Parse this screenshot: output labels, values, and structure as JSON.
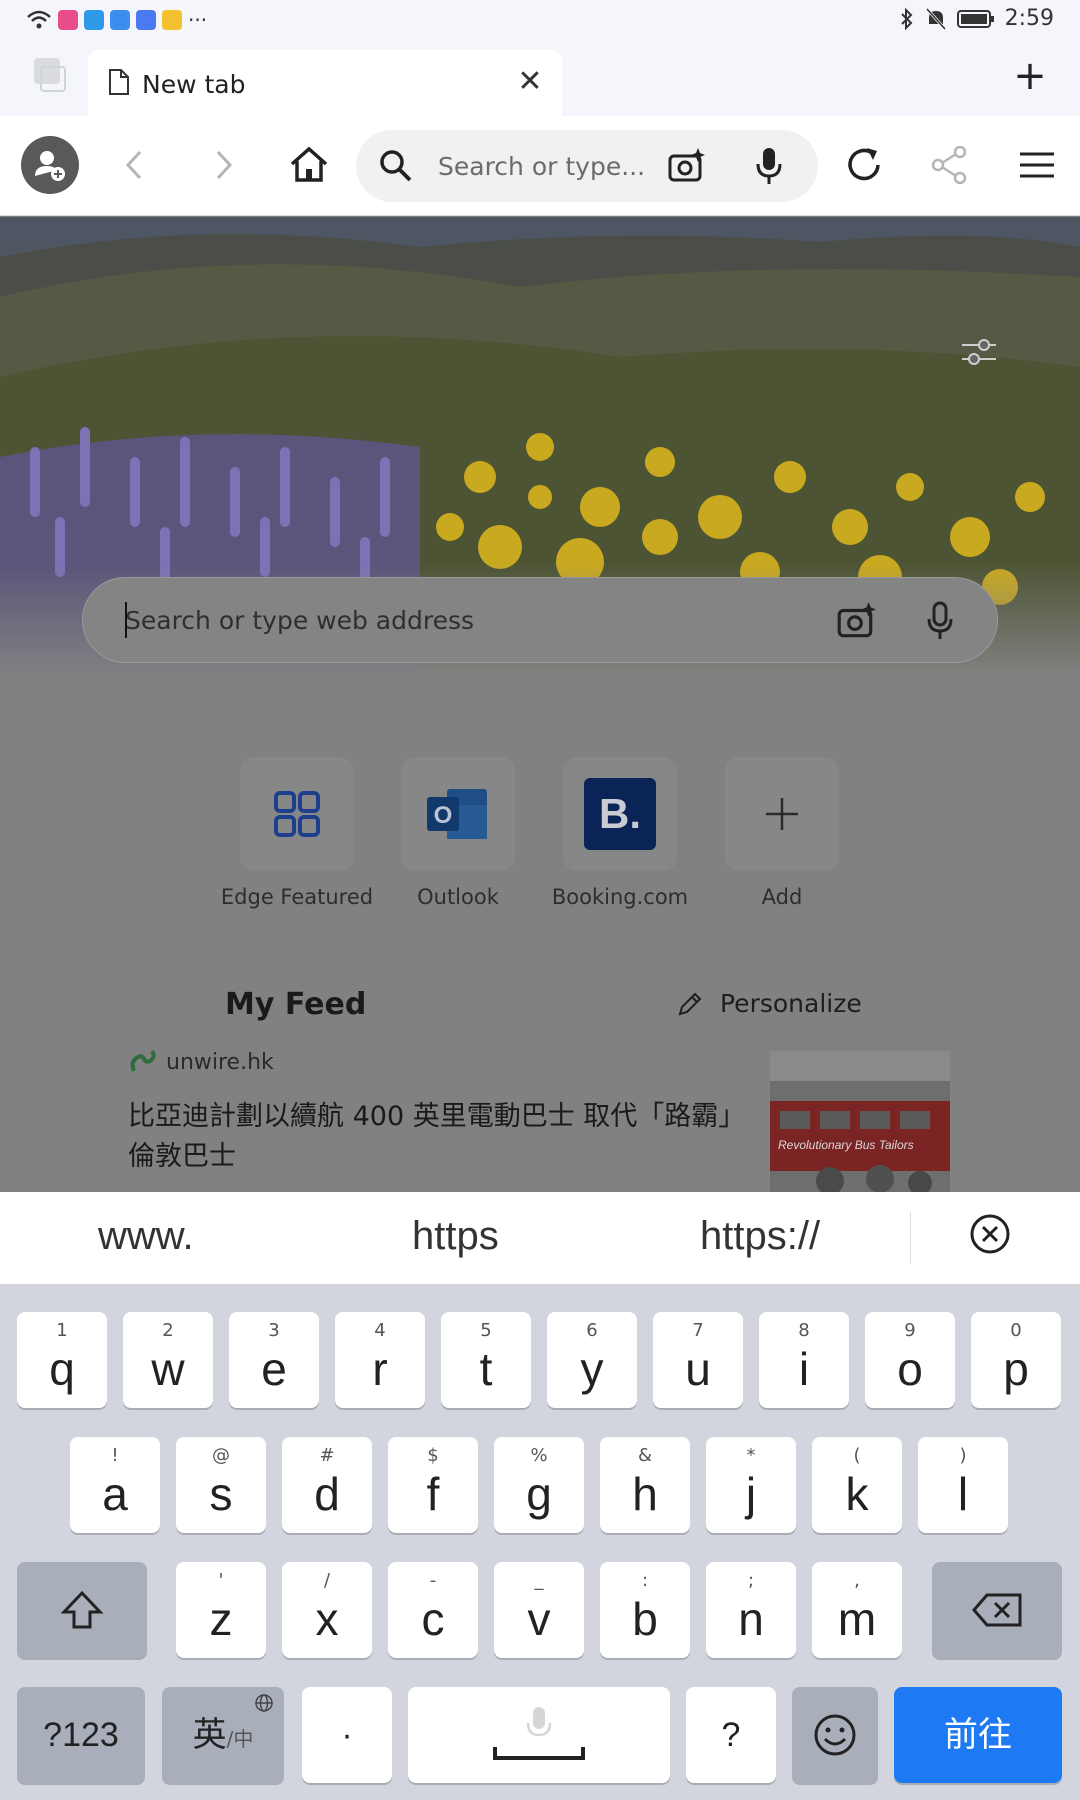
{
  "status_bar": {
    "time": "2:59",
    "notification_icons": [
      "wifi-icon",
      "app-icon-1",
      "app-icon-2",
      "cloud-icon",
      "mail-icon",
      "message-icon"
    ],
    "more_indicator": "···"
  },
  "tab": {
    "title": "New tab"
  },
  "toolbar": {
    "address_placeholder": "Search or type..."
  },
  "page": {
    "search_placeholder": "Search or type web address",
    "quick_links": [
      {
        "label": "Edge Featured",
        "icon": "grid-icon"
      },
      {
        "label": "Outlook",
        "icon": "outlook-icon"
      },
      {
        "label": "Booking.com",
        "icon": "booking-icon",
        "glyph": "B."
      },
      {
        "label": "Add",
        "icon": "plus-icon"
      }
    ],
    "feed": {
      "title": "My Feed",
      "personalize_label": "Personalize",
      "source": "unwire.hk",
      "headline": "比亞迪計劃以續航 400 英里電動巴士 取代「路霸」倫敦巴士",
      "thumbnail_caption": "Revolutionary Bus Tailors"
    }
  },
  "suggestions": [
    "www.",
    "https",
    "https://"
  ],
  "keyboard": {
    "row1": [
      {
        "hint": "1",
        "char": "q"
      },
      {
        "hint": "2",
        "char": "w"
      },
      {
        "hint": "3",
        "char": "e"
      },
      {
        "hint": "4",
        "char": "r"
      },
      {
        "hint": "5",
        "char": "t"
      },
      {
        "hint": "6",
        "char": "y"
      },
      {
        "hint": "7",
        "char": "u"
      },
      {
        "hint": "8",
        "char": "i"
      },
      {
        "hint": "9",
        "char": "o"
      },
      {
        "hint": "0",
        "char": "p"
      }
    ],
    "row2": [
      {
        "hint": "!",
        "char": "a"
      },
      {
        "hint": "@",
        "char": "s"
      },
      {
        "hint": "#",
        "char": "d"
      },
      {
        "hint": "$",
        "char": "f"
      },
      {
        "hint": "%",
        "char": "g"
      },
      {
        "hint": "&",
        "char": "h"
      },
      {
        "hint": "*",
        "char": "j"
      },
      {
        "hint": "(",
        "char": "k"
      },
      {
        "hint": ")",
        "char": "l"
      }
    ],
    "row3": [
      {
        "hint": "'",
        "char": "z"
      },
      {
        "hint": "/",
        "char": "x"
      },
      {
        "hint": "-",
        "char": "c"
      },
      {
        "hint": "_",
        "char": "v"
      },
      {
        "hint": ":",
        "char": "b"
      },
      {
        "hint": ";",
        "char": "n"
      },
      {
        "hint": ",",
        "char": "m"
      }
    ],
    "numbers_label": "?123",
    "lang_main": "英",
    "lang_sub": "/中",
    "period_label": "·",
    "question_label": "?",
    "go_label": "前往",
    "accent_color": "#1d7af3"
  }
}
